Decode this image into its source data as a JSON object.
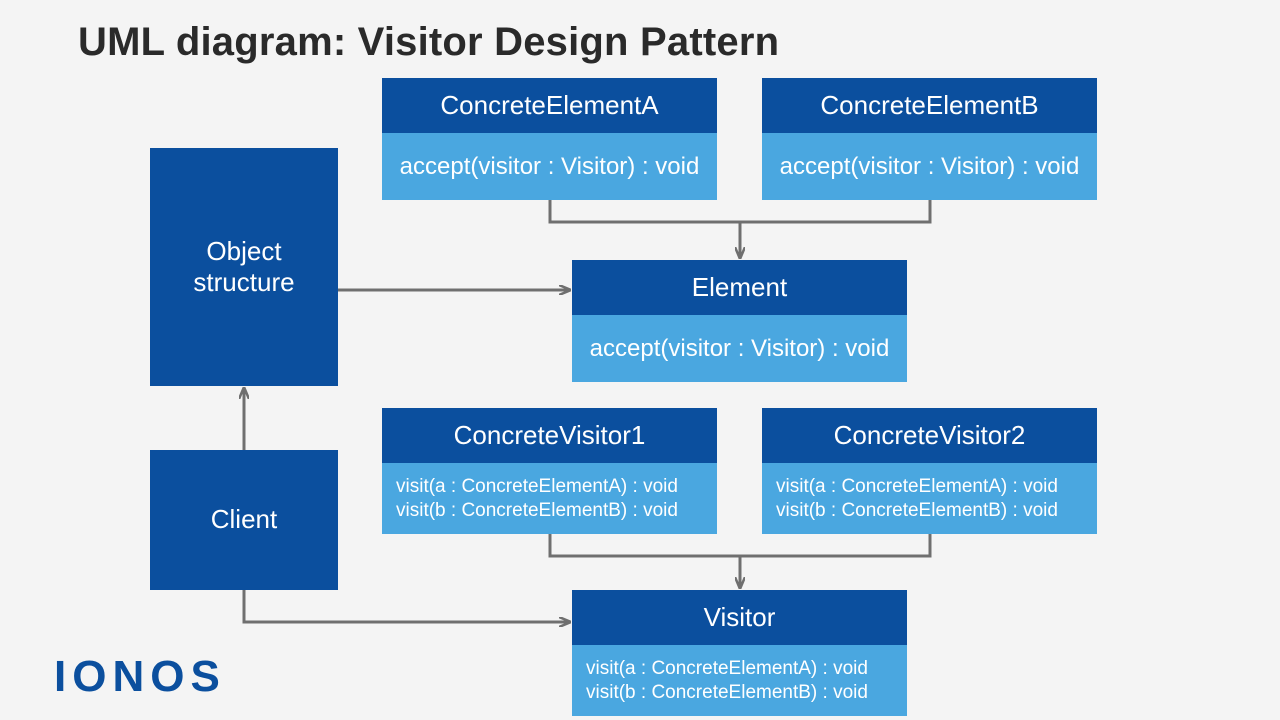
{
  "title": "UML diagram: Visitor Design Pattern",
  "brand": "IONOS",
  "colors": {
    "dark_blue": "#0b4f9e",
    "light_blue": "#4aa7e0",
    "arrow": "#6f6f6f",
    "bg": "#f4f4f4"
  },
  "nodes": {
    "object_structure": {
      "lines": [
        "Object",
        "structure"
      ]
    },
    "client": {
      "label": "Client"
    },
    "concrete_element_a": {
      "name": "ConcreteElementA",
      "methods": [
        "accept(visitor : Visitor) : void"
      ]
    },
    "concrete_element_b": {
      "name": "ConcreteElementB",
      "methods": [
        "accept(visitor : Visitor) : void"
      ]
    },
    "element": {
      "name": "Element",
      "methods": [
        "accept(visitor : Visitor) : void"
      ]
    },
    "concrete_visitor_1": {
      "name": "ConcreteVisitor1",
      "methods": [
        "visit(a : ConcreteElementA) : void",
        "visit(b : ConcreteElementB) : void"
      ]
    },
    "concrete_visitor_2": {
      "name": "ConcreteVisitor2",
      "methods": [
        "visit(a : ConcreteElementA) : void",
        "visit(b : ConcreteElementB) : void"
      ]
    },
    "visitor": {
      "name": "Visitor",
      "methods": [
        "visit(a : ConcreteElementA) : void",
        "visit(b : ConcreteElementB) : void"
      ]
    }
  },
  "edges": [
    {
      "from": "client",
      "to": "object_structure",
      "type": "arrow"
    },
    {
      "from": "object_structure",
      "to": "element",
      "type": "arrow"
    },
    {
      "from": "concrete_element_a",
      "to": "element",
      "type": "generalization_join"
    },
    {
      "from": "concrete_element_b",
      "to": "element",
      "type": "generalization_join"
    },
    {
      "from": "client",
      "to": "visitor",
      "type": "arrow"
    },
    {
      "from": "concrete_visitor_1",
      "to": "visitor",
      "type": "generalization_join"
    },
    {
      "from": "concrete_visitor_2",
      "to": "visitor",
      "type": "generalization_join"
    }
  ]
}
